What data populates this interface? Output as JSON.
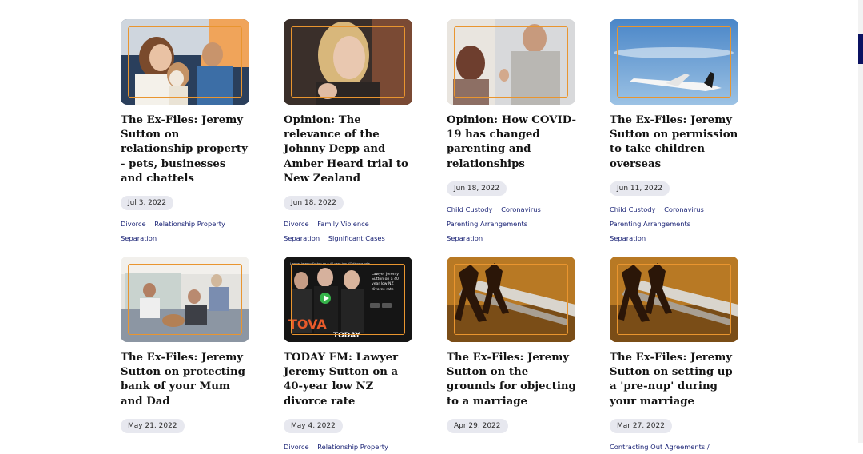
{
  "articles": [
    {
      "title": "The Ex-Files: Jeremy Sutton on relationship property - pets, businesses and chattels",
      "date": "Jul 3, 2022",
      "tags": [
        "Divorce",
        "Relationship Property",
        "Separation"
      ],
      "image": "woman-with-dog-in-car"
    },
    {
      "title": "Opinion: The relevance of the Johnny Depp and Amber Heard trial to New Zealand",
      "date": "Jun 18, 2022",
      "tags": [
        "Divorce",
        "Family Violence",
        "Separation",
        "Significant Cases"
      ],
      "image": "woman-in-courtroom"
    },
    {
      "title": "Opinion: How COVID-19 has changed parenting and relationships",
      "date": "Jun 18, 2022",
      "tags": [
        "Child Custody",
        "Coronavirus",
        "Parenting Arrangements",
        "Separation"
      ],
      "image": "couple-arguing"
    },
    {
      "title": "The Ex-Files: Jeremy Sutton on permission to take children overseas",
      "date": "Jun 11, 2022",
      "tags": [
        "Child Custody",
        "Coronavirus",
        "Parenting Arrangements",
        "Separation"
      ],
      "image": "airplane-in-sky"
    },
    {
      "title": "The Ex-Files: Jeremy Sutton on protecting bank of your Mum and Dad",
      "date": "May 21, 2022",
      "tags": [],
      "image": "family-in-living-room"
    },
    {
      "title": "TODAY FM: Lawyer Jeremy Sutton on a 40-year low NZ divorce rate",
      "date": "May 4, 2022",
      "tags": [
        "Divorce",
        "Relationship Property"
      ],
      "image": "today-fm-video"
    },
    {
      "title": "The Ex-Files: Jeremy Sutton on the grounds for objecting to a marriage",
      "date": "Apr 29, 2022",
      "tags": [],
      "image": "scissors-cutting-paper-figures"
    },
    {
      "title": "The Ex-Files: Jeremy Sutton on setting up a 'pre-nup' during your marriage",
      "date": "Mar 27, 2022",
      "tags": [
        "Contracting Out Agreements /"
      ],
      "image": "scissors-cutting-paper-figures"
    }
  ],
  "video": {
    "banner": "Lawyer Jeremy Sutton on a 40 year low NZ divorce rate",
    "caption": "Lawyer Jeremy Sutton on a 40 year low NZ divorce rate",
    "brand_left": "TOVA",
    "brand_right": "TODAY"
  },
  "colors": {
    "accent_frame": "#e9952f",
    "tag": "#161f73",
    "scroll_thumb": "#0b1262"
  }
}
